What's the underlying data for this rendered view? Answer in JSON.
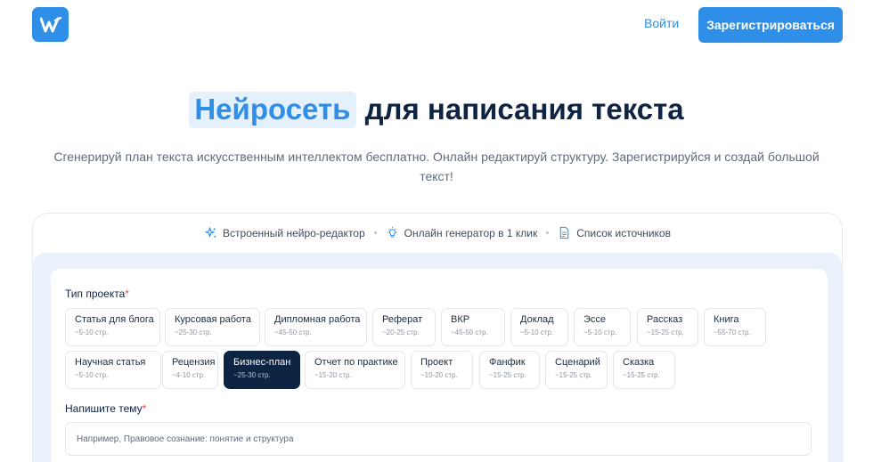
{
  "header": {
    "login_label": "Войти",
    "register_label": "Зарегистрироваться"
  },
  "hero": {
    "title_highlight": "Нейросеть",
    "title_rest": " для написания текста",
    "subtitle": "Сгенерируй план текста искусственным интеллектом бесплатно. Онлайн редактируй структуру. Зарегистрируйся и создай большой текст!"
  },
  "features": [
    {
      "label": "Встроенный нейро-редактор",
      "icon": "sparkle-icon"
    },
    {
      "label": "Онлайн генератор в 1 клик",
      "icon": "lightbulb-icon"
    },
    {
      "label": "Список источников",
      "icon": "document-icon"
    }
  ],
  "form": {
    "project_type_label": "Тип проекта",
    "required_mark": "*",
    "topic_label": "Напишите тему",
    "topic_placeholder": "Например, Правовое сознание: понятие и структура",
    "project_types_row1": [
      {
        "title": "Статья для блога",
        "pages": "~5-10 стр."
      },
      {
        "title": "Курсовая работа",
        "pages": "~25-30 стр."
      },
      {
        "title": "Дипломная работа",
        "pages": "~45-50 стр."
      },
      {
        "title": "Реферат",
        "pages": "~20-25 стр."
      },
      {
        "title": "ВКР",
        "pages": "~45-50 стр."
      },
      {
        "title": "Доклад",
        "pages": "~5-10 стр."
      },
      {
        "title": "Эссе",
        "pages": "~5-10 стр."
      },
      {
        "title": "Рассказ",
        "pages": "~15-25 стр."
      },
      {
        "title": "Книга",
        "pages": "~55-70 стр."
      }
    ],
    "project_types_row2": [
      {
        "title": "Научная статья",
        "pages": "~5-10 стр."
      },
      {
        "title": "Рецензия",
        "pages": "~4-10 стр."
      },
      {
        "title": "Бизнес-план",
        "pages": "~25-30 стр."
      },
      {
        "title": "Отчет по практике",
        "pages": "~15-20 стр."
      },
      {
        "title": "Проект",
        "pages": "~10-20 стр."
      },
      {
        "title": "Фанфик",
        "pages": "~15-25 стр."
      },
      {
        "title": "Сценарий",
        "pages": "~15-25 стр."
      },
      {
        "title": "Сказка",
        "pages": "~15-25 стр."
      }
    ],
    "selected_type": "Бизнес-план"
  },
  "colors": {
    "accent": "#2f8fe8",
    "dark": "#0d2543",
    "required": "#e5484d"
  }
}
